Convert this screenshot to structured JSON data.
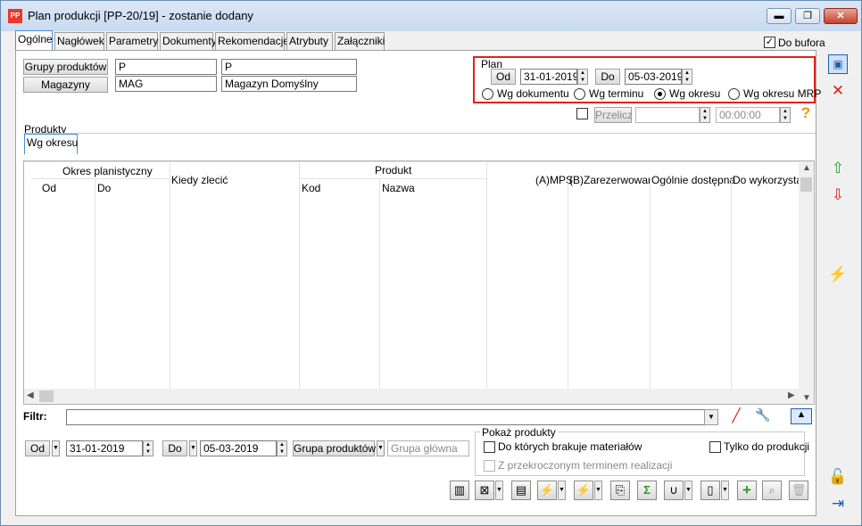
{
  "window": {
    "title": "Plan produkcji [PP-20/19] - zostanie dodany",
    "app_icon_text": "PP",
    "minimize": "▬",
    "maximize": "❐",
    "close": "✕"
  },
  "tabs": [
    {
      "label": "Ogólne"
    },
    {
      "label": "Nagłówek"
    },
    {
      "label": "Parametry"
    },
    {
      "label": "Dokumenty"
    },
    {
      "label": "Rekomendacje"
    },
    {
      "label": "Atrybuty"
    },
    {
      "label": "Załączniki"
    }
  ],
  "do_bufora": {
    "label": "Do bufora",
    "checked": true,
    "check": "✓"
  },
  "filters_top": {
    "grupy_button": "Grupy produktów",
    "grupy_code": "P",
    "grupy_name": "P",
    "magazyny_button": "Magazyny",
    "magazyn_code": "MAG",
    "magazyn_name": "Magazyn Domyślny"
  },
  "plan": {
    "title": "Plan",
    "od_button": "Od",
    "od_value": "31-01-2019",
    "do_button": "Do",
    "do_value": "05-03-2019",
    "radios": [
      {
        "label": "Wg dokumentu",
        "checked": false
      },
      {
        "label": "Wg terminu",
        "checked": false
      },
      {
        "label": "Wg okresu",
        "checked": true
      },
      {
        "label": "Wg okresu MRP",
        "checked": false
      }
    ]
  },
  "przelicz": {
    "button": "Przelicz",
    "date": "",
    "time": "00:00:00"
  },
  "produkty": {
    "label": "Produkty",
    "subtab": "Wg okresu",
    "columns": {
      "okres": "Okres planistyczny",
      "od": "Od",
      "do": "Do",
      "kiedy": "Kiedy zlecić",
      "produkt": "Produkt",
      "kod": "Kod",
      "nazwa": "Nazwa",
      "mps": "(A)MPS",
      "zarez": "(B)Zarezerwowana",
      "ogolnie": "Ogólnie dostępna",
      "dowyk": "Do wykorzystania"
    }
  },
  "filtr": {
    "label": "Filtr:",
    "value": ""
  },
  "bottom": {
    "od_button": "Od",
    "od_value": "31-01-2019",
    "do_button": "Do",
    "do_value": "05-03-2019",
    "grupa_button": "Grupa produktów",
    "grupa_placeholder": "Grupa główna"
  },
  "pokaz": {
    "title": "Pokaż produkty",
    "brakuje": {
      "label": "Do których brakuje materiałów",
      "checked": false
    },
    "tylko": {
      "label": "Tylko do produkcji",
      "checked": false
    },
    "przekroczony": {
      "label": "Z przekroczonym terminem realizacji",
      "checked": false
    }
  },
  "colors": {
    "accent_red": "#e1211b",
    "tab_active_border": "#4a8ed8"
  }
}
